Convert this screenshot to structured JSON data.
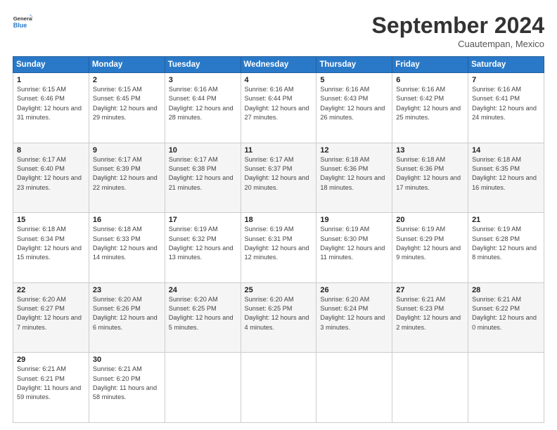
{
  "header": {
    "logo_line1": "General",
    "logo_line2": "Blue",
    "month_title": "September 2024",
    "subtitle": "Cuautempan, Mexico"
  },
  "weekdays": [
    "Sunday",
    "Monday",
    "Tuesday",
    "Wednesday",
    "Thursday",
    "Friday",
    "Saturday"
  ],
  "weeks": [
    [
      {
        "day": "1",
        "rise": "6:15 AM",
        "set": "6:46 PM",
        "daylight": "12 hours and 31 minutes."
      },
      {
        "day": "2",
        "rise": "6:15 AM",
        "set": "6:45 PM",
        "daylight": "12 hours and 29 minutes."
      },
      {
        "day": "3",
        "rise": "6:16 AM",
        "set": "6:44 PM",
        "daylight": "12 hours and 28 minutes."
      },
      {
        "day": "4",
        "rise": "6:16 AM",
        "set": "6:44 PM",
        "daylight": "12 hours and 27 minutes."
      },
      {
        "day": "5",
        "rise": "6:16 AM",
        "set": "6:43 PM",
        "daylight": "12 hours and 26 minutes."
      },
      {
        "day": "6",
        "rise": "6:16 AM",
        "set": "6:42 PM",
        "daylight": "12 hours and 25 minutes."
      },
      {
        "day": "7",
        "rise": "6:16 AM",
        "set": "6:41 PM",
        "daylight": "12 hours and 24 minutes."
      }
    ],
    [
      {
        "day": "8",
        "rise": "6:17 AM",
        "set": "6:40 PM",
        "daylight": "12 hours and 23 minutes."
      },
      {
        "day": "9",
        "rise": "6:17 AM",
        "set": "6:39 PM",
        "daylight": "12 hours and 22 minutes."
      },
      {
        "day": "10",
        "rise": "6:17 AM",
        "set": "6:38 PM",
        "daylight": "12 hours and 21 minutes."
      },
      {
        "day": "11",
        "rise": "6:17 AM",
        "set": "6:37 PM",
        "daylight": "12 hours and 20 minutes."
      },
      {
        "day": "12",
        "rise": "6:18 AM",
        "set": "6:36 PM",
        "daylight": "12 hours and 18 minutes."
      },
      {
        "day": "13",
        "rise": "6:18 AM",
        "set": "6:36 PM",
        "daylight": "12 hours and 17 minutes."
      },
      {
        "day": "14",
        "rise": "6:18 AM",
        "set": "6:35 PM",
        "daylight": "12 hours and 16 minutes."
      }
    ],
    [
      {
        "day": "15",
        "rise": "6:18 AM",
        "set": "6:34 PM",
        "daylight": "12 hours and 15 minutes."
      },
      {
        "day": "16",
        "rise": "6:18 AM",
        "set": "6:33 PM",
        "daylight": "12 hours and 14 minutes."
      },
      {
        "day": "17",
        "rise": "6:19 AM",
        "set": "6:32 PM",
        "daylight": "12 hours and 13 minutes."
      },
      {
        "day": "18",
        "rise": "6:19 AM",
        "set": "6:31 PM",
        "daylight": "12 hours and 12 minutes."
      },
      {
        "day": "19",
        "rise": "6:19 AM",
        "set": "6:30 PM",
        "daylight": "12 hours and 11 minutes."
      },
      {
        "day": "20",
        "rise": "6:19 AM",
        "set": "6:29 PM",
        "daylight": "12 hours and 9 minutes."
      },
      {
        "day": "21",
        "rise": "6:19 AM",
        "set": "6:28 PM",
        "daylight": "12 hours and 8 minutes."
      }
    ],
    [
      {
        "day": "22",
        "rise": "6:20 AM",
        "set": "6:27 PM",
        "daylight": "12 hours and 7 minutes."
      },
      {
        "day": "23",
        "rise": "6:20 AM",
        "set": "6:26 PM",
        "daylight": "12 hours and 6 minutes."
      },
      {
        "day": "24",
        "rise": "6:20 AM",
        "set": "6:25 PM",
        "daylight": "12 hours and 5 minutes."
      },
      {
        "day": "25",
        "rise": "6:20 AM",
        "set": "6:25 PM",
        "daylight": "12 hours and 4 minutes."
      },
      {
        "day": "26",
        "rise": "6:20 AM",
        "set": "6:24 PM",
        "daylight": "12 hours and 3 minutes."
      },
      {
        "day": "27",
        "rise": "6:21 AM",
        "set": "6:23 PM",
        "daylight": "12 hours and 2 minutes."
      },
      {
        "day": "28",
        "rise": "6:21 AM",
        "set": "6:22 PM",
        "daylight": "12 hours and 0 minutes."
      }
    ],
    [
      {
        "day": "29",
        "rise": "6:21 AM",
        "set": "6:21 PM",
        "daylight": "11 hours and 59 minutes."
      },
      {
        "day": "30",
        "rise": "6:21 AM",
        "set": "6:20 PM",
        "daylight": "11 hours and 58 minutes."
      },
      null,
      null,
      null,
      null,
      null
    ]
  ]
}
